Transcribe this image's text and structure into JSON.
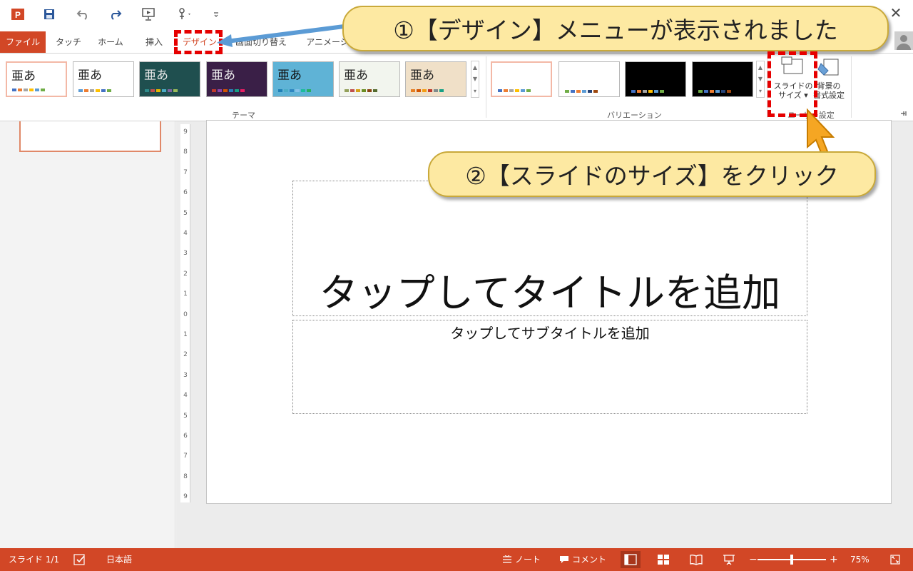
{
  "qat": {
    "icons": [
      "powerpoint-logo-icon",
      "save-icon",
      "undo-icon",
      "redo-icon",
      "start-slideshow-icon",
      "touch-mode-icon",
      "customize-qat-icon"
    ]
  },
  "window": {
    "close_label": "✕"
  },
  "tabs": [
    {
      "label": "ファイル"
    },
    {
      "label": "タッチ"
    },
    {
      "label": "ホーム"
    },
    {
      "label": "挿入"
    },
    {
      "label": "デザイン"
    },
    {
      "label": "画面切り替え"
    },
    {
      "label": "アニメーション"
    }
  ],
  "ribbon": {
    "themes_group_label": "テーマ",
    "variations_group_label": "バリエーション",
    "customize_group_label": "ユーザー設定",
    "themes": [
      {
        "label": "亜あ",
        "bg": "#ffffff",
        "fg": "#222222",
        "dots": [
          "#4472c4",
          "#ed7d31",
          "#a5a5a5",
          "#ffc000",
          "#5b9bd5",
          "#70ad47"
        ]
      },
      {
        "label": "亜あ",
        "bg": "#ffffff",
        "fg": "#222222",
        "dots": [
          "#5b9bd5",
          "#ed7d31",
          "#a5a5a5",
          "#ffc000",
          "#4472c4",
          "#70ad47"
        ]
      },
      {
        "label": "亜あ",
        "bg": "#1f4f4f",
        "fg": "#e8e8e8",
        "dots": [
          "#2e8b8b",
          "#c0504d",
          "#e6b800",
          "#4bacc6",
          "#8064a2",
          "#9bbb59"
        ]
      },
      {
        "label": "亜あ",
        "bg": "#3a1f47",
        "fg": "#f0f0f0",
        "dots": [
          "#c0392b",
          "#8e44ad",
          "#d35400",
          "#2980b9",
          "#16a085",
          "#e91e63"
        ]
      },
      {
        "label": "亜あ",
        "bg": "#5fb3d6",
        "fg": "#111111",
        "dots": [
          "#1f7fb6",
          "#4bacc6",
          "#2e86c1",
          "#85c1e9",
          "#1abc9c",
          "#27ae60"
        ]
      },
      {
        "label": "亜あ",
        "bg": "#f2f5ee",
        "fg": "#222222",
        "dots": [
          "#93a05a",
          "#c0504d",
          "#d4a017",
          "#6b8e23",
          "#8b4513",
          "#556b2f"
        ]
      },
      {
        "label": "亜あ",
        "bg": "#f0e0c8",
        "fg": "#222222",
        "dots": [
          "#e67e22",
          "#d35400",
          "#f39c12",
          "#c0392b",
          "#7f8c8d",
          "#16a085"
        ]
      }
    ],
    "variations": [
      {
        "bg": "#ffffff",
        "dots": [
          "#4472c4",
          "#ed7d31",
          "#a5a5a5",
          "#ffc000",
          "#5b9bd5",
          "#70ad47"
        ]
      },
      {
        "bg": "#ffffff",
        "dots": [
          "#70ad47",
          "#4472c4",
          "#ed7d31",
          "#5b9bd5",
          "#264478",
          "#9e480e"
        ]
      },
      {
        "bg": "#000000",
        "dots": [
          "#4472c4",
          "#ed7d31",
          "#a5a5a5",
          "#ffc000",
          "#5b9bd5",
          "#70ad47"
        ]
      },
      {
        "bg": "#000000",
        "dots": [
          "#70ad47",
          "#4472c4",
          "#ed7d31",
          "#5b9bd5",
          "#264478",
          "#9e480e"
        ]
      }
    ],
    "slide_size": {
      "line1": "スライドの",
      "line2": "サイズ ▾"
    },
    "format_background": {
      "line1": "背景の",
      "line2": "書式設定"
    }
  },
  "slide": {
    "title_placeholder": "タップしてタイトルを追加",
    "subtitle_placeholder": "タップしてサブタイトルを追加"
  },
  "ruler": {
    "ticks": [
      "9",
      "8",
      "7",
      "6",
      "5",
      "4",
      "3",
      "2",
      "1",
      "0",
      "1",
      "2",
      "3",
      "4",
      "5",
      "6",
      "7",
      "8",
      "9"
    ]
  },
  "status": {
    "slide_info": "スライド 1/1",
    "language": "日本語",
    "notes_label": "ノート",
    "comments_label": "コメント",
    "zoom_minus": "−",
    "zoom_plus": "+",
    "zoom_level": "75%",
    "zoom_fraction": 0.5
  },
  "annotations": {
    "callout1": "①【デザイン】メニューが表示されました",
    "callout2": "②【スライドのサイズ】をクリック",
    "accent_red": "#e60000",
    "callout_fill": "#fde9a2",
    "arrow_color": "#5b9bd5",
    "cursor_color": "#f5a623"
  },
  "colors": {
    "accent": "#d24726",
    "file_tab": "#d24726",
    "thumb_border": "#e08868"
  }
}
